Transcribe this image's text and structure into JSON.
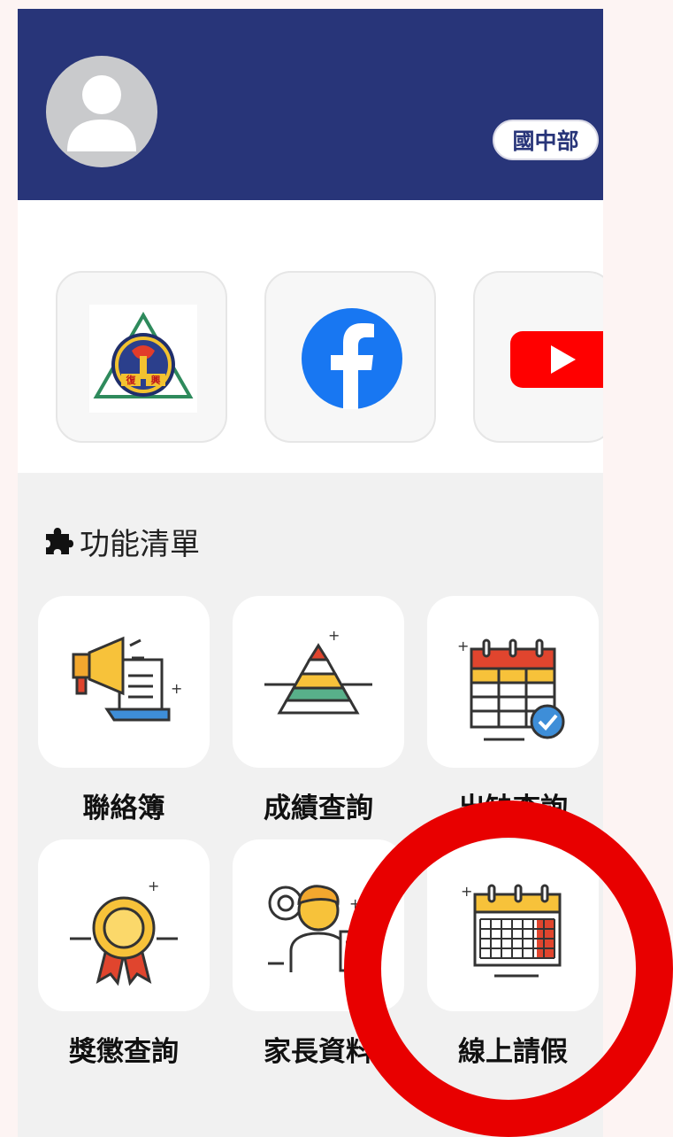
{
  "header": {
    "department_badge": "國中部",
    "accent_color": "#283579"
  },
  "quick_links": [
    {
      "name": "school-logo",
      "icon": "school-emblem-icon"
    },
    {
      "name": "facebook",
      "icon": "facebook-icon"
    },
    {
      "name": "youtube",
      "icon": "youtube-icon"
    }
  ],
  "functions": {
    "section_title": "功能清單",
    "section_icon": "puzzle-icon",
    "items": [
      {
        "label": "聯絡簿",
        "icon": "megaphone-notice-icon"
      },
      {
        "label": "成績查詢",
        "icon": "pyramid-chart-icon"
      },
      {
        "label": "出缺查詢",
        "icon": "calendar-check-icon"
      },
      {
        "label": "獎懲查詢",
        "icon": "award-medal-icon"
      },
      {
        "label": "家長資料",
        "icon": "parent-profile-icon"
      },
      {
        "label": "線上請假",
        "icon": "calendar-leave-icon"
      }
    ]
  },
  "annotation": {
    "color": "#e80000",
    "shape": "circle"
  }
}
